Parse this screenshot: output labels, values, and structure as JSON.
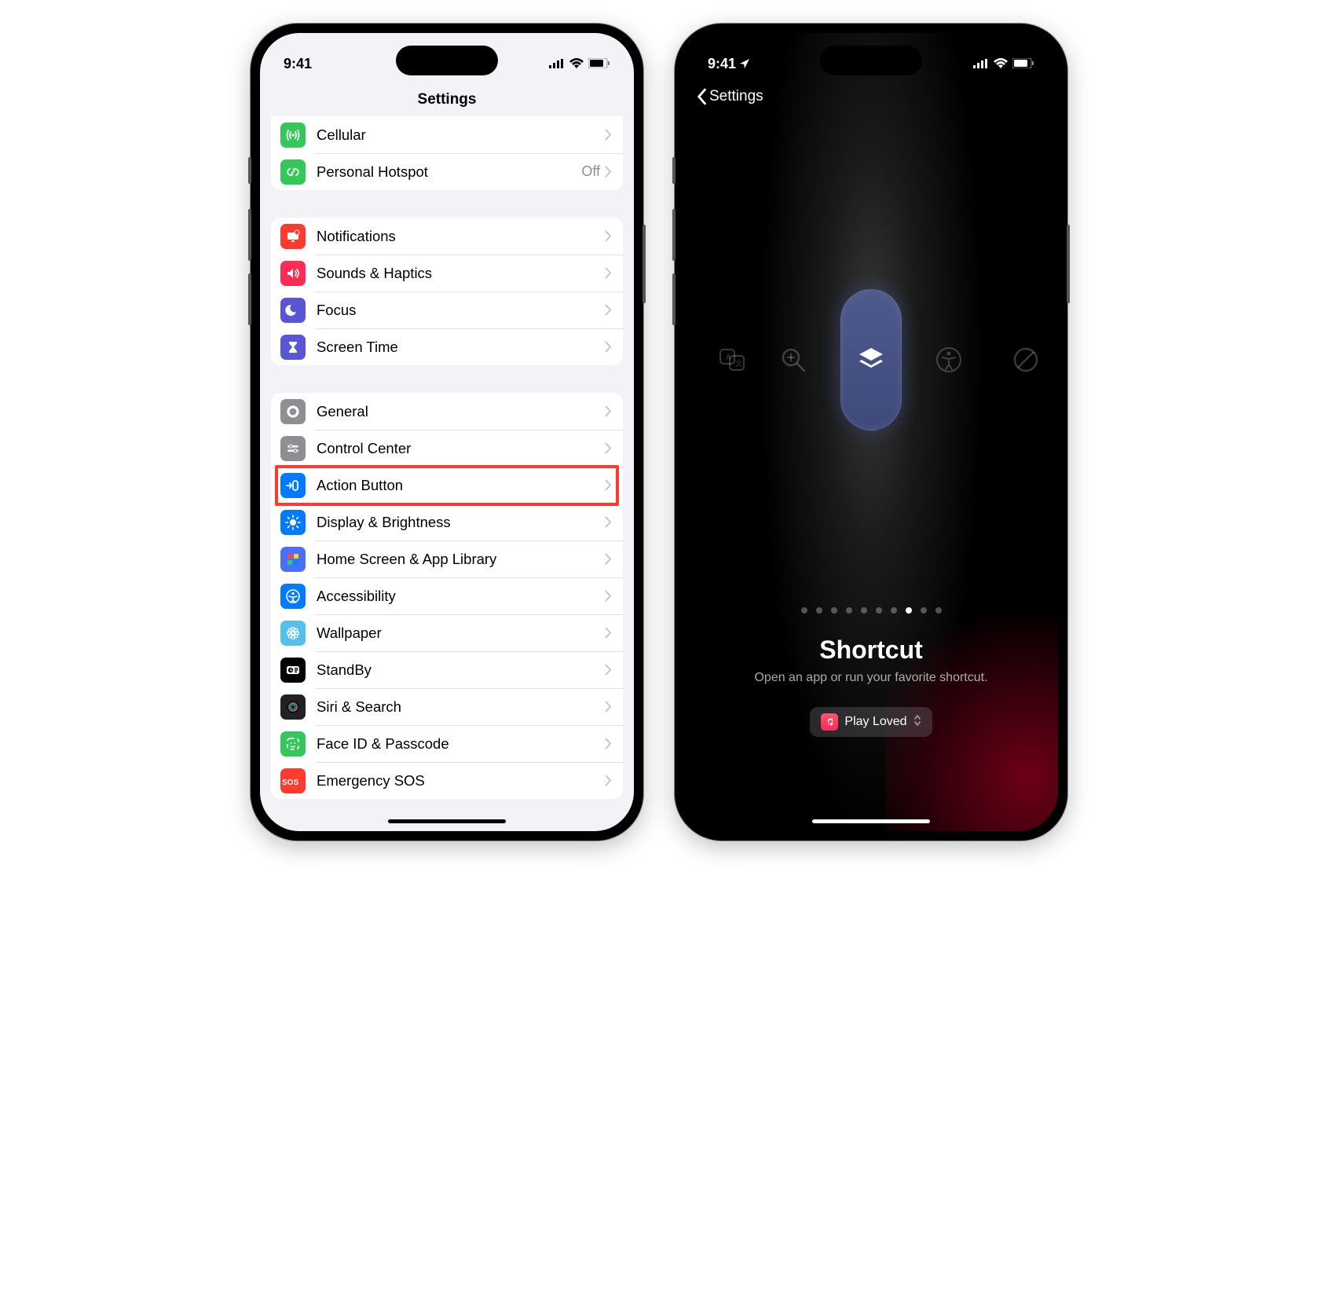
{
  "statusbar": {
    "time": "9:41"
  },
  "left": {
    "title": "Settings",
    "group1": [
      {
        "id": "cellular",
        "label": "Cellular",
        "color": "#34c759",
        "icon": "antenna"
      },
      {
        "id": "hotspot",
        "label": "Personal Hotspot",
        "color": "#34c759",
        "icon": "link",
        "detail": "Off"
      }
    ],
    "group2": [
      {
        "id": "notifications",
        "label": "Notifications",
        "color": "#ff3b30",
        "icon": "bell"
      },
      {
        "id": "sounds",
        "label": "Sounds & Haptics",
        "color": "#ff2d55",
        "icon": "speaker"
      },
      {
        "id": "focus",
        "label": "Focus",
        "color": "#5856d6",
        "icon": "moon"
      },
      {
        "id": "screentime",
        "label": "Screen Time",
        "color": "#5856d6",
        "icon": "hourglass"
      }
    ],
    "group3": [
      {
        "id": "general",
        "label": "General",
        "color": "#8e8e93",
        "icon": "gear"
      },
      {
        "id": "controlcenter",
        "label": "Control Center",
        "color": "#8e8e93",
        "icon": "sliders"
      },
      {
        "id": "actionbutton",
        "label": "Action Button",
        "color": "#007aff",
        "icon": "action",
        "highlight": true
      },
      {
        "id": "display",
        "label": "Display & Brightness",
        "color": "#007aff",
        "icon": "sun"
      },
      {
        "id": "homescreen",
        "label": "Home Screen & App Library",
        "color": "#4b6eff",
        "icon": "grid"
      },
      {
        "id": "accessibility",
        "label": "Accessibility",
        "color": "#007aff",
        "icon": "person"
      },
      {
        "id": "wallpaper",
        "label": "Wallpaper",
        "color": "#56c1e8",
        "icon": "flower"
      },
      {
        "id": "standby",
        "label": "StandBy",
        "color": "#000000",
        "icon": "clock"
      },
      {
        "id": "siri",
        "label": "Siri & Search",
        "color": "#222222",
        "icon": "siri"
      },
      {
        "id": "faceid",
        "label": "Face ID & Passcode",
        "color": "#34c759",
        "icon": "face"
      },
      {
        "id": "sos",
        "label": "Emergency SOS",
        "color": "#ff3b30",
        "icon": "sos"
      }
    ]
  },
  "right": {
    "back": "Settings",
    "mode_title": "Shortcut",
    "mode_desc": "Open an app or run your favorite shortcut.",
    "shortcut_name": "Play Loved",
    "page_count": 10,
    "active_page_index": 7
  }
}
